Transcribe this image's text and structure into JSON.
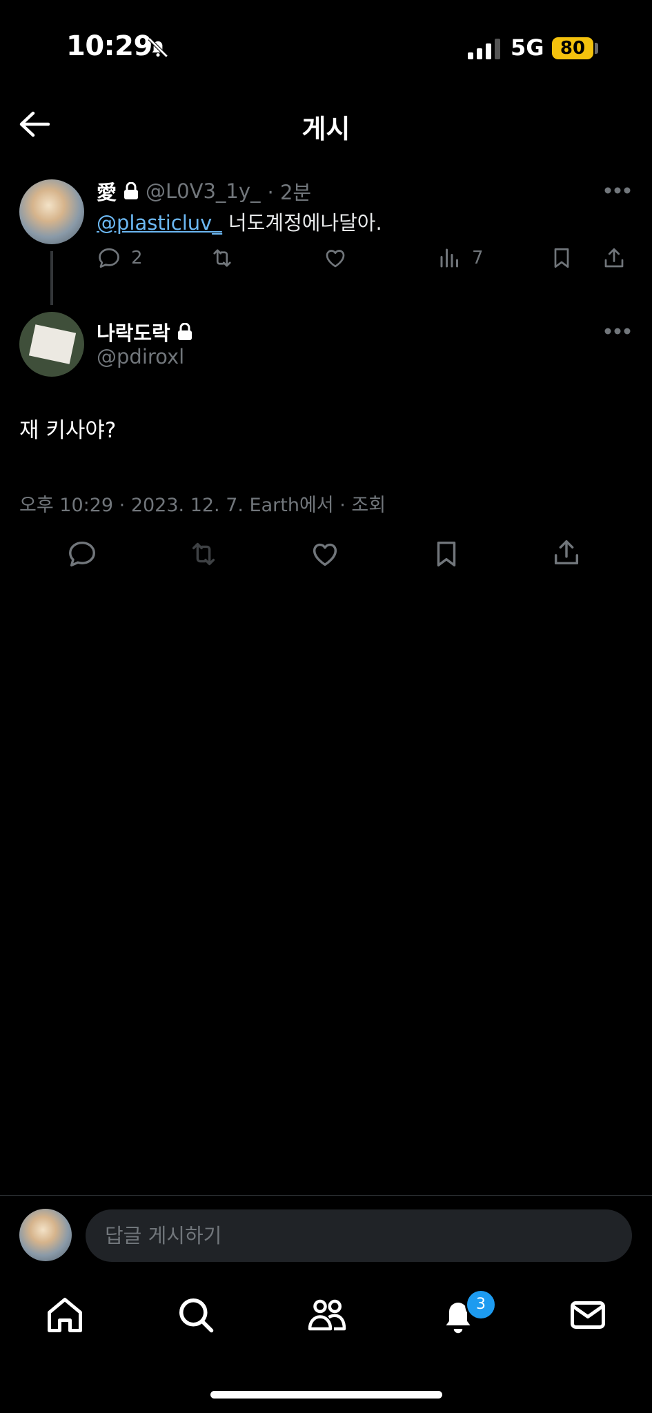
{
  "status_bar": {
    "time": "10:29",
    "network": "5G",
    "battery": "80",
    "battery_color": "#f4c20d"
  },
  "header": {
    "title": "게시"
  },
  "parent_tweet": {
    "name": "愛",
    "handle": "@L0V3_1y_",
    "time": "· 2분",
    "mention": "@plasticluv_",
    "text": " 너도계정에나달아.",
    "reply_count": "2",
    "view_count": "7"
  },
  "main_tweet": {
    "name": "나락도락",
    "handle": "@pdiroxl",
    "text": "재 키사야?",
    "meta": "오후 10:29 · 2023. 12. 7. Earth에서 · 조회"
  },
  "composer": {
    "placeholder": "답글 게시하기"
  },
  "tab_bar": {
    "notifications_badge": "3"
  },
  "colors": {
    "accent": "#1d9bf0",
    "mention": "#6cb8f3",
    "muted": "#71767b"
  }
}
